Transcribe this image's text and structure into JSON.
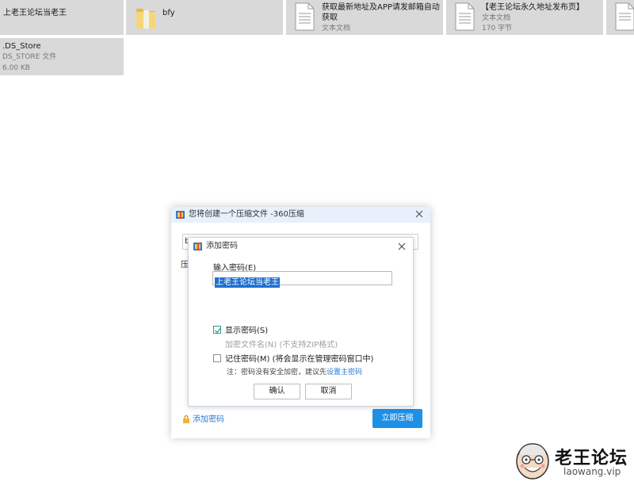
{
  "files": [
    {
      "name": "上老王论坛当老王",
      "sub1": "",
      "sub2": "",
      "icon": "none"
    },
    {
      "name": "bfy",
      "sub1": "",
      "sub2": "",
      "icon": "folder-icon"
    },
    {
      "name": "获取最新地址及APP请发邮箱自动",
      "name2": "获取",
      "sub1": "文本文档",
      "sub2": "",
      "icon": "text-document-icon"
    },
    {
      "name": "【老王论坛永久地址发布页】",
      "sub1": "文本文档",
      "sub2": "170 字节",
      "icon": "text-document-icon"
    },
    {
      "name": ".DS_Store",
      "sub1": "DS_STORE 文件",
      "sub2": "6.00 KB",
      "icon": "none"
    }
  ],
  "outer_dialog": {
    "title": "您将创建一个压缩文件 -360压缩",
    "path_value": "b",
    "partial_label": "压",
    "add_password_link": "添加密码",
    "compress_button": "立即压缩"
  },
  "password_dialog": {
    "title": "添加密码",
    "password_label": "输入密码(E)",
    "password_value": "上老王论坛当老王",
    "show_password": {
      "label": "显示密码(S)",
      "checked": true
    },
    "encrypt_filename": {
      "label": "加密文件名(N) (不支持ZIP格式)",
      "enabled": false
    },
    "remember_password": {
      "label": "记住密码(M) (将会显示在管理密码窗口中)",
      "checked": false
    },
    "note_text": "注：密码没有安全加密，建议先",
    "note_link": "设置主密码",
    "ok_button": "确认",
    "cancel_button": "取消"
  },
  "watermark": {
    "title": "老王论坛",
    "url": "laowang.vip"
  },
  "colors": {
    "tile_bg": "#d9d9d9",
    "accent": "#1e90e6",
    "link": "#2a7bd4",
    "selection": "#1f6fd1",
    "titlebar_bg": "#e8f1fb"
  }
}
